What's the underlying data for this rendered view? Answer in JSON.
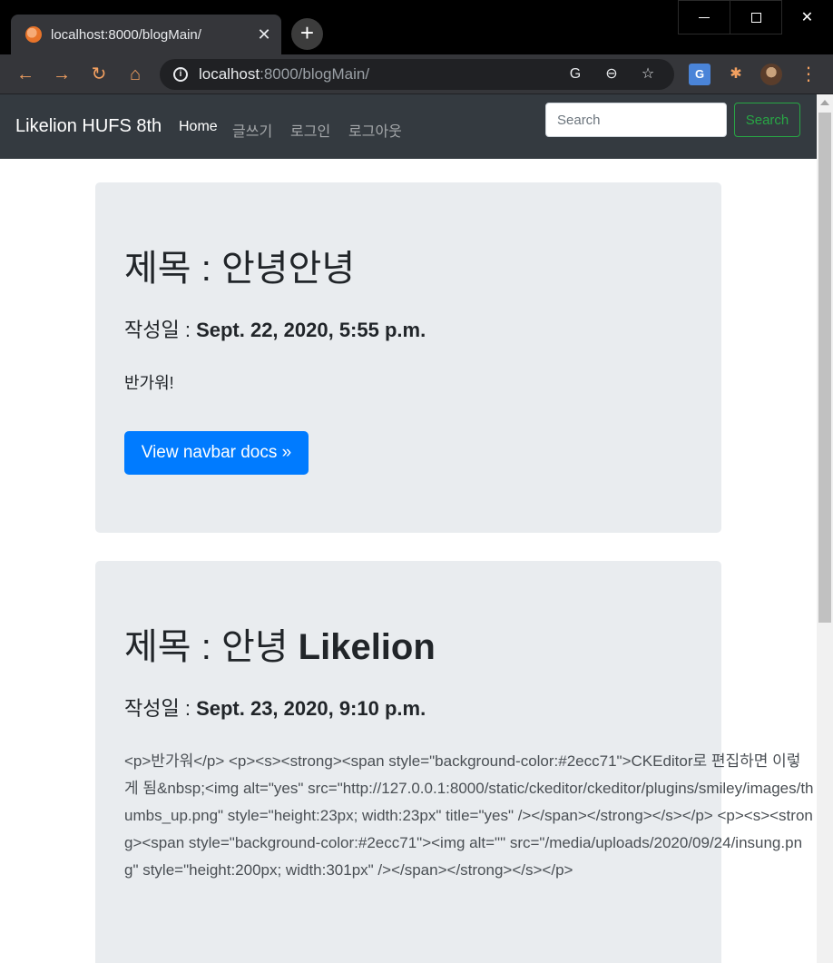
{
  "browser": {
    "tab_title": "localhost:8000/blogMain/",
    "tab_close": "✕",
    "new_tab": "+",
    "url_host": "localhost",
    "url_path": ":8000/blogMain/",
    "back": "←",
    "forward": "→",
    "reload": "↻",
    "home": "⌂",
    "translate": "G",
    "zoom": "⊖",
    "star": "☆",
    "extensions": "✱",
    "menu": "⋮",
    "close": "✕"
  },
  "navbar": {
    "brand": "Likelion HUFS 8th",
    "links": [
      "Home",
      "글쓰기",
      "로그인",
      "로그아웃"
    ],
    "search_placeholder": "Search",
    "search_button": "Search"
  },
  "posts": [
    {
      "title_prefix": "제목 : ",
      "title": "안녕안녕",
      "date_label": "작성일 : ",
      "date": "Sept. 22, 2020, 5:55 p.m.",
      "body": "반가워!",
      "button": "View navbar docs »"
    },
    {
      "title_prefix": "제목 : 안녕 ",
      "title": "Likelion",
      "date_label": "작성일 : ",
      "date": "Sept. 23, 2020, 9:10 p.m.",
      "body": "<p>반가워</p> <p><s><strong><span style=\"background-color:#2ecc71\">CKEditor로 편집하면 이렇게 됨&nbsp;<img alt=\"yes\" src=\"http://127.0.0.1:8000/static/ckeditor/ckeditor/plugins/smiley/images/thumbs_up.png\" style=\"height:23px; width:23px\" title=\"yes\" /></span></strong></s></p> <p><s><strong><span style=\"background-color:#2ecc71\"><img alt=\"\" src=\"/media/uploads/2020/09/24/insung.png\" style=\"height:200px; width:301px\" /></span></strong></s></p>"
    }
  ],
  "colors": {
    "navbar_bg": "#343a40",
    "jumbotron_bg": "#e9ecef",
    "primary": "#007bff",
    "success": "#28a745"
  }
}
